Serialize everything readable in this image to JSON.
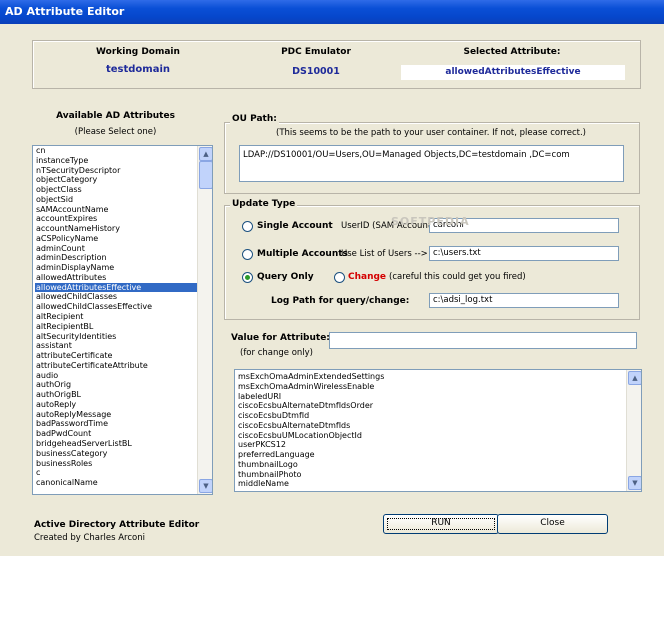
{
  "window": {
    "title": "AD Attribute Editor"
  },
  "header": {
    "working_domain_label": "Working Domain",
    "working_domain_value": "testdomain",
    "pdc_label": "PDC Emulator",
    "pdc_value": "DS10001",
    "selected_attr_label": "Selected Attribute:",
    "selected_attr_value": "allowedAttributesEffective"
  },
  "attributes_panel": {
    "title": "Available AD Attributes",
    "subtitle": "(Please Select one)",
    "selected_index": 14,
    "items": [
      "cn",
      "instanceType",
      "nTSecurityDescriptor",
      "objectCategory",
      "objectClass",
      "objectSid",
      "sAMAccountName",
      "accountExpires",
      "accountNameHistory",
      "aCSPolicyName",
      "adminCount",
      "adminDescription",
      "adminDisplayName",
      "allowedAttributes",
      "allowedAttributesEffective",
      "allowedChildClasses",
      "allowedChildClassesEffective",
      "altRecipient",
      "altRecipientBL",
      "altSecurityIdentities",
      "assistant",
      "attributeCertificate",
      "attributeCertificateAttribute",
      "audio",
      "authOrig",
      "authOrigBL",
      "autoReply",
      "autoReplyMessage",
      "badPasswordTime",
      "badPwdCount",
      "bridgeheadServerListBL",
      "businessCategory",
      "businessRoles",
      "c",
      "canonicalName"
    ]
  },
  "ou_path": {
    "label": "OU Path:",
    "hint": "(This seems to be the path to your user container. If not, please correct.)",
    "value": "LDAP://DS10001/OU=Users,OU=Managed Objects,DC=testdomain ,DC=com"
  },
  "update_type": {
    "label": "Update Type",
    "single_label": "Single Account",
    "userid_label": "UserID (SAM Account)",
    "userid_value": "carconi",
    "multiple_label": "Multiple Accounts",
    "list_label": "Use List of Users -->",
    "list_value": "c:\\users.txt",
    "query_label": "Query Only",
    "change_label": "Change",
    "change_warning": "(careful this could get you fired)",
    "log_label": "Log Path for query/change:",
    "log_value": "c:\\adsi_log.txt",
    "selected": "query",
    "watermark": "SOFTPEDIA"
  },
  "value_section": {
    "label": "Value for Attribute:",
    "sublabel": "(for change only)",
    "value": ""
  },
  "values_list": {
    "items": [
      "msExchOmaAdminExtendedSettings",
      "msExchOmaAdminWirelessEnable",
      "labeledURI",
      "ciscoEcsbuAlternateDtmfIdsOrder",
      "ciscoEcsbuDtmfId",
      "ciscoEcsbuAlternateDtmfIds",
      "ciscoEcsbuUMLocationObjectId",
      "userPKCS12",
      "preferredLanguage",
      "thumbnailLogo",
      "thumbnailPhoto",
      "middleName"
    ]
  },
  "footer": {
    "app_name": "Active Directory Attribute Editor",
    "credit": "Created by Charles Arconi"
  },
  "buttons": {
    "run": "RUN",
    "close": "Close"
  },
  "colors": {
    "accent_blue": "#1e2a9a",
    "selection": "#316ac5",
    "warning_red": "#d40000",
    "titlebar": "#0a4fd6"
  }
}
